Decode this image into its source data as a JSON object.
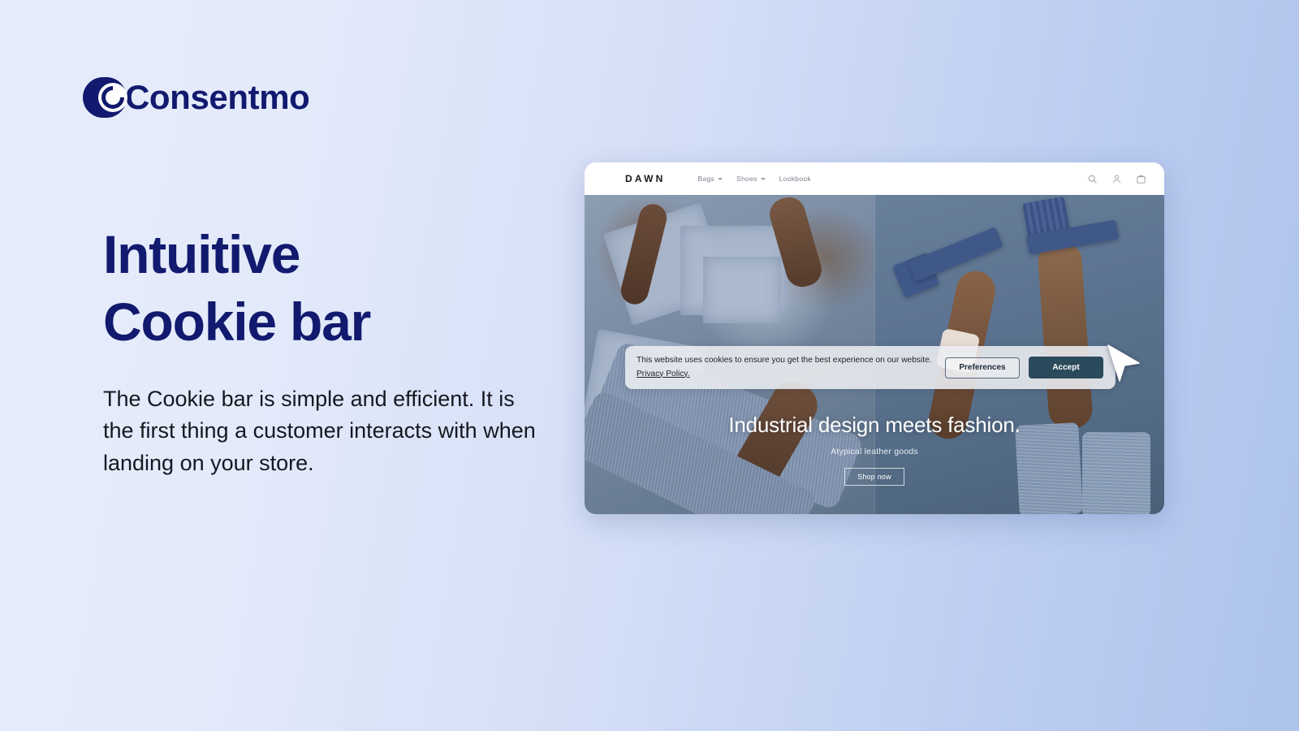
{
  "brand": {
    "name": "Consentmo",
    "logo_icon": "consentmo-c-mark",
    "color": "#111a6e"
  },
  "hero_copy": {
    "headline_line1": "Intuitive",
    "headline_line2": "Cookie bar",
    "body": "The Cookie bar is simple and efficient. It is the first thing a customer interacts with when landing on your store."
  },
  "mockup": {
    "store_logo": "DAWN",
    "nav": [
      {
        "label": "Bags",
        "has_dropdown": true
      },
      {
        "label": "Shoes",
        "has_dropdown": true
      },
      {
        "label": "Lookbook",
        "has_dropdown": false
      }
    ],
    "icons": [
      {
        "name": "search-icon"
      },
      {
        "name": "account-icon"
      },
      {
        "name": "cart-icon"
      }
    ],
    "hero": {
      "title": "Industrial design meets fashion.",
      "subtitle": "Atypical leather goods",
      "cta": "Shop now"
    },
    "cookie_bar": {
      "message": "This website uses cookies to ensure you get the best experience on our website. ",
      "link": "Privacy Policy.",
      "preferences_label": "Preferences",
      "accept_label": "Accept",
      "accept_color": "#2b4a5b"
    },
    "cursor_icon": "arrow-pointer"
  },
  "background": {
    "from": "#e7ecfb",
    "to": "#adc3ec"
  }
}
